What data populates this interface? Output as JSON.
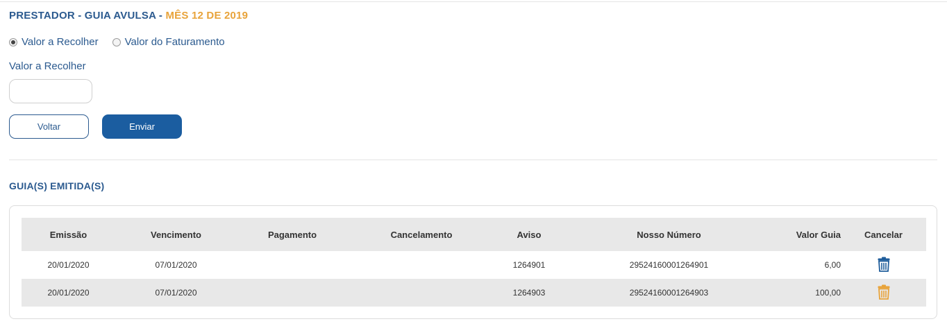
{
  "header": {
    "title_prefix": "PRESTADOR - GUIA AVULSA - ",
    "title_period": "MÊS 12 DE 2019"
  },
  "form": {
    "radio_options": [
      {
        "label": "Valor a Recolher",
        "checked": true
      },
      {
        "label": "Valor do Faturamento",
        "checked": false
      }
    ],
    "field_label": "Valor a Recolher",
    "field_value": "",
    "back_label": "Voltar",
    "send_label": "Enviar"
  },
  "section": {
    "title": "GUIA(S) EMITIDA(S)"
  },
  "table": {
    "columns": [
      "Emissão",
      "Vencimento",
      "Pagamento",
      "Cancelamento",
      "Aviso",
      "Nosso Número",
      "Valor Guia",
      "Cancelar"
    ],
    "rows": [
      {
        "emissao": "20/01/2020",
        "vencimento": "07/01/2020",
        "pagamento": "",
        "cancelamento": "",
        "aviso": "1264901",
        "nosso_numero": "29524160001264901",
        "valor": "6,00",
        "cancel_icon": "trash-icon",
        "cancel_color": "#1f5d9b"
      },
      {
        "emissao": "20/01/2020",
        "vencimento": "07/01/2020",
        "pagamento": "",
        "cancelamento": "",
        "aviso": "1264903",
        "nosso_numero": "29524160001264903",
        "valor": "100,00",
        "cancel_icon": "trash-icon",
        "cancel_color": "#e8a33a"
      }
    ]
  },
  "colors": {
    "primary": "#2b5a8f",
    "accent": "#e8a33a",
    "button": "#1b5da0"
  }
}
